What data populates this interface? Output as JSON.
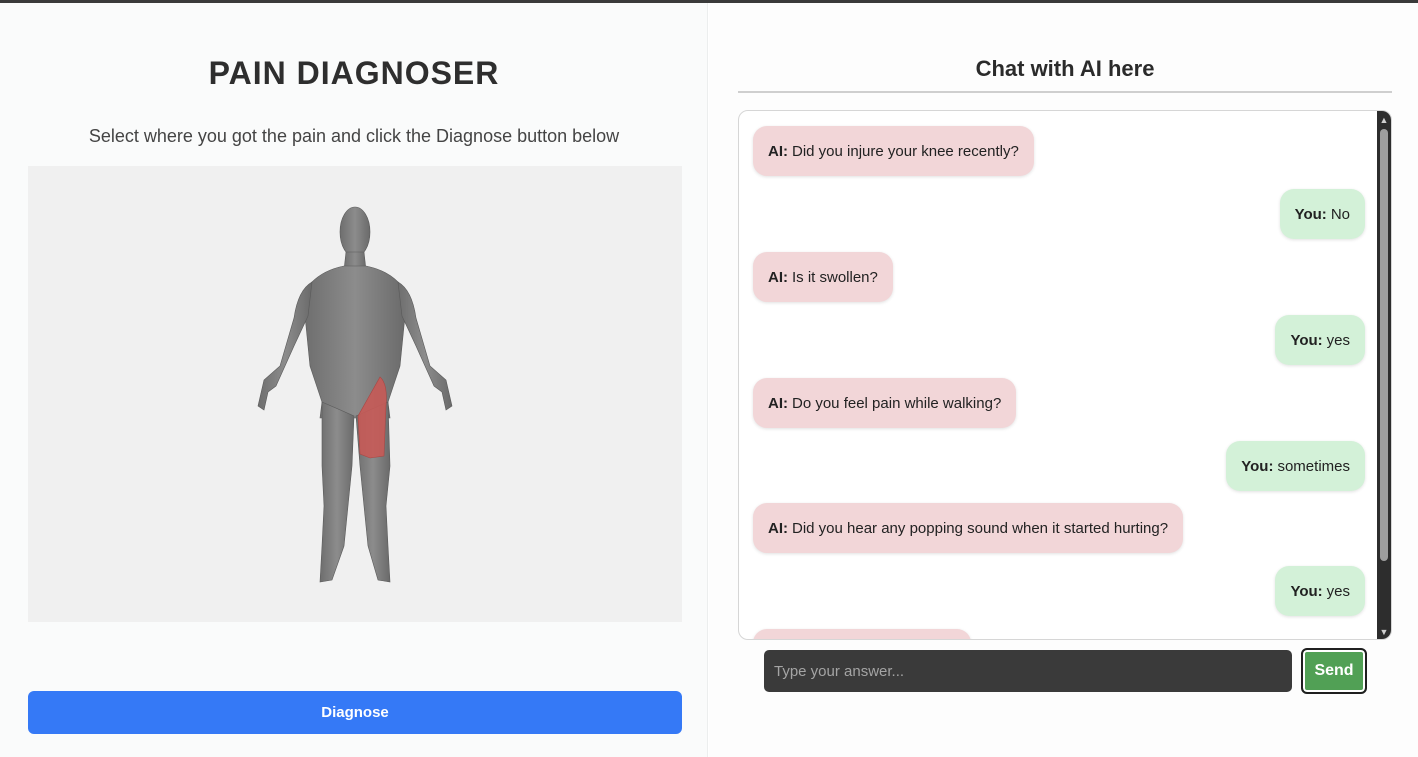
{
  "left": {
    "title": "PAIN DIAGNOSER",
    "subtitle": "Select where you got the pain and click the Diagnose button below",
    "diagnose_label": "Diagnose",
    "highlight_color": "#c65a57"
  },
  "chat": {
    "title": "Chat with AI here",
    "messages": [
      {
        "sender": "AI:",
        "text": "Did you injure your knee recently?",
        "role": "ai"
      },
      {
        "sender": "You:",
        "text": "No",
        "role": "you"
      },
      {
        "sender": "AI:",
        "text": "Is it swollen?",
        "role": "ai"
      },
      {
        "sender": "You:",
        "text": "yes",
        "role": "you"
      },
      {
        "sender": "AI:",
        "text": "Do you feel pain while walking?",
        "role": "ai"
      },
      {
        "sender": "You:",
        "text": "sometimes",
        "role": "you"
      },
      {
        "sender": "AI:",
        "text": "Did you hear any popping sound when it started hurting?",
        "role": "ai"
      },
      {
        "sender": "You:",
        "text": "yes",
        "role": "you"
      },
      {
        "sender": "AI:",
        "text": "",
        "role": "ai"
      }
    ],
    "input_placeholder": "Type your answer...",
    "send_label": "Send"
  }
}
